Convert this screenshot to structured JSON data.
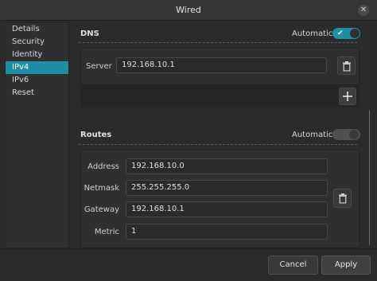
{
  "window": {
    "title": "Wired"
  },
  "sidebar": {
    "items": [
      {
        "label": "Details"
      },
      {
        "label": "Security"
      },
      {
        "label": "Identity"
      },
      {
        "label": "IPv4",
        "active": true
      },
      {
        "label": "IPv6"
      },
      {
        "label": "Reset"
      }
    ]
  },
  "dns": {
    "title": "DNS",
    "automatic_label": "Automatic",
    "automatic_on": true,
    "server_label": "Server",
    "server_value": "192.168.10.1"
  },
  "routes": {
    "title": "Routes",
    "automatic_label": "Automatic",
    "automatic_on": false,
    "address_label": "Address",
    "address_value": "192.168.10.0",
    "netmask_label": "Netmask",
    "netmask_value": "255.255.255.0",
    "gateway_label": "Gateway",
    "gateway_value": "192.168.10.1",
    "metric_label": "Metric",
    "metric_value": "1"
  },
  "footer": {
    "cancel_label": "Cancel",
    "apply_label": "Apply"
  },
  "colors": {
    "accent": "#1e8fa6",
    "background": "#2b2b2b"
  },
  "icons": {
    "close": "close-icon",
    "trash": "trash-icon",
    "add": "plus-icon",
    "check": "check-icon"
  }
}
